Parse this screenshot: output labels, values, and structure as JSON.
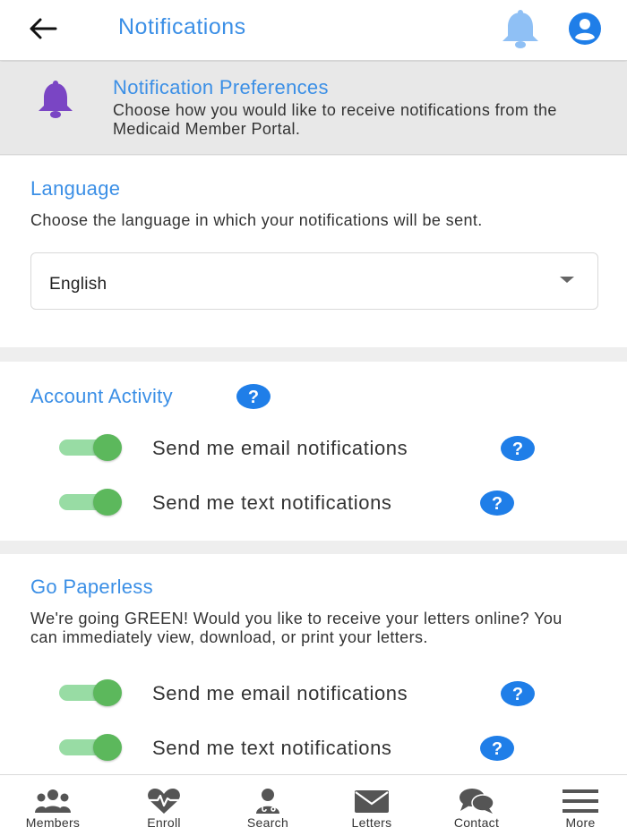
{
  "header": {
    "title": "Notifications",
    "back_icon": "arrow-left-icon",
    "bell_icon": "bell-icon",
    "account_icon": "account-circle-icon"
  },
  "preferences": {
    "title": "Notification Preferences",
    "description": "Choose how you would like to receive notifications from the Medicaid Member Portal.",
    "icon": "bell-icon"
  },
  "language": {
    "title": "Language",
    "description": "Choose the language in which your notifications will be sent.",
    "selected": "English"
  },
  "account_activity": {
    "title": "Account Activity",
    "toggles": [
      {
        "label": "Send me email notifications",
        "on": true
      },
      {
        "label": "Send me text notifications",
        "on": true
      }
    ]
  },
  "paperless": {
    "title": "Go Paperless",
    "description": "We're going GREEN! Would you like to receive your letters online? You can immediately view, download, or print your letters.",
    "toggles": [
      {
        "label": "Send me email notifications",
        "on": true
      },
      {
        "label": "Send me text notifications",
        "on": true
      }
    ]
  },
  "bottom_nav": [
    {
      "label": "Members",
      "icon": "members-icon"
    },
    {
      "label": "Enroll",
      "icon": "heart-pulse-icon"
    },
    {
      "label": "Search",
      "icon": "doctor-icon"
    },
    {
      "label": "Letters",
      "icon": "envelope-icon"
    },
    {
      "label": "Contact",
      "icon": "chat-bubbles-icon"
    },
    {
      "label": "More",
      "icon": "menu-icon"
    }
  ],
  "colors": {
    "accent": "#3b8fe6",
    "bell_header": "#8fc0f5",
    "bell_preferences": "#7a45c4",
    "toggle_on": "#5cb85c",
    "help": "#1f7ee8"
  }
}
